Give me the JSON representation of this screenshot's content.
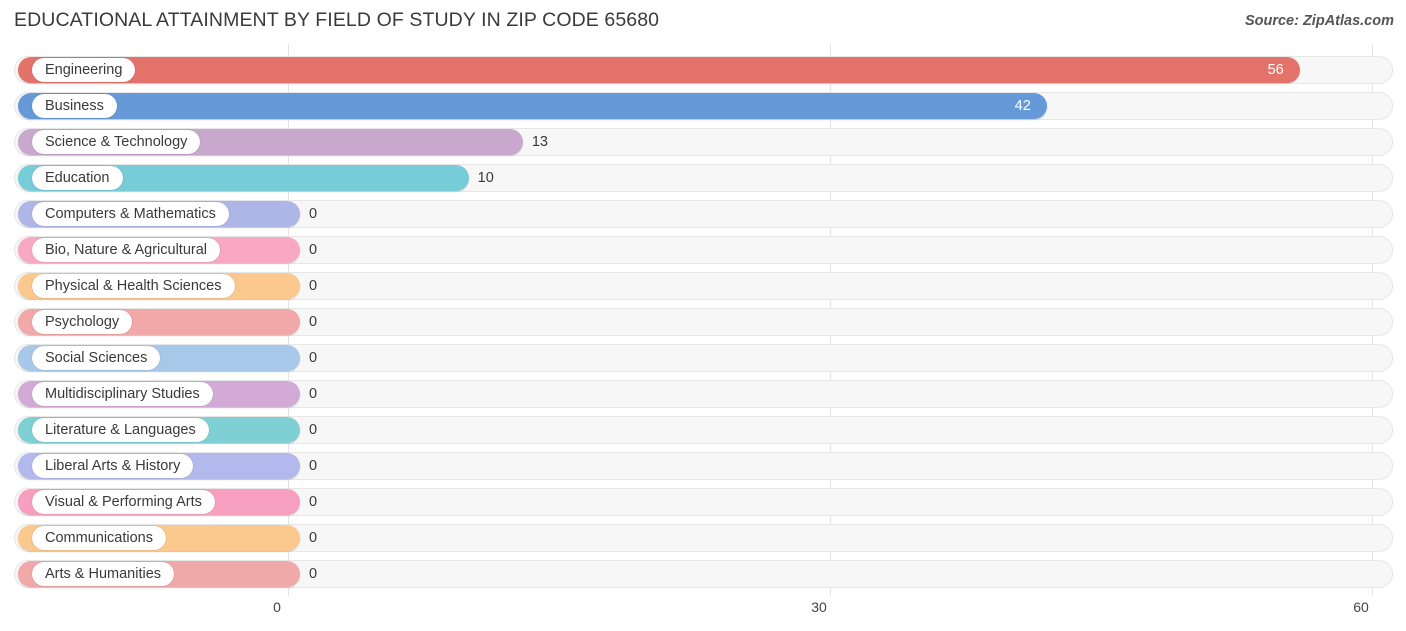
{
  "header": {
    "title": "EDUCATIONAL ATTAINMENT BY FIELD OF STUDY IN ZIP CODE 65680",
    "source": "Source: ZipAtlas.com"
  },
  "chart_data": {
    "type": "bar",
    "orientation": "horizontal",
    "title": "EDUCATIONAL ATTAINMENT BY FIELD OF STUDY IN ZIP CODE 65680",
    "xlabel": "",
    "ylabel": "",
    "xlim": [
      0,
      60
    ],
    "xticks": [
      "0",
      "30",
      "60"
    ],
    "xtick_values": [
      0,
      30,
      60
    ],
    "grid": true,
    "legend": false,
    "categories": [
      "Engineering",
      "Business",
      "Science & Technology",
      "Education",
      "Computers & Mathematics",
      "Bio, Nature & Agricultural",
      "Physical & Health Sciences",
      "Psychology",
      "Social Sciences",
      "Multidisciplinary Studies",
      "Literature & Languages",
      "Liberal Arts & History",
      "Visual & Performing Arts",
      "Communications",
      "Arts & Humanities"
    ],
    "values": [
      56,
      42,
      13,
      10,
      0,
      0,
      0,
      0,
      0,
      0,
      0,
      0,
      0,
      0,
      0
    ],
    "value_labels": [
      "56",
      "42",
      "13",
      "10",
      "0",
      "0",
      "0",
      "0",
      "0",
      "0",
      "0",
      "0",
      "0",
      "0",
      "0"
    ],
    "colors": [
      "#e2726a",
      "#6699d8",
      "#c9a8cd",
      "#76cdd8",
      "#aeb6e8",
      "#f9a8c4",
      "#fbc88d",
      "#f0a8a8",
      "#a8c8ea",
      "#d3a9d6",
      "#7fd0d4",
      "#b3b9ec",
      "#f79fbe",
      "#fbc88d",
      "#f0a8a8"
    ]
  }
}
